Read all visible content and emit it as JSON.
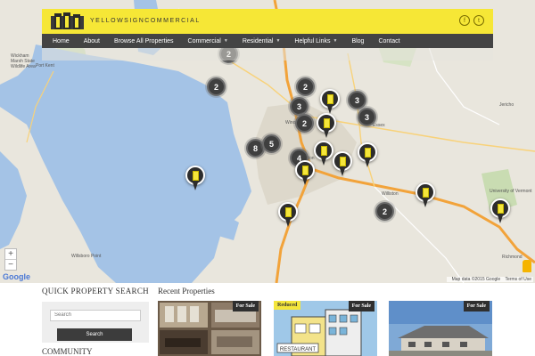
{
  "header": {
    "logo_text": "YELLOWSIGNCOMMERCIAL",
    "social": [
      "f",
      "t"
    ]
  },
  "nav": [
    {
      "label": "Home",
      "dropdown": false
    },
    {
      "label": "About",
      "dropdown": false
    },
    {
      "label": "Browse All Properties",
      "dropdown": false
    },
    {
      "label": "Commercial",
      "dropdown": true
    },
    {
      "label": "Residential",
      "dropdown": true
    },
    {
      "label": "Helpful Links",
      "dropdown": true
    },
    {
      "label": "Blog",
      "dropdown": false
    },
    {
      "label": "Contact",
      "dropdown": false
    }
  ],
  "map": {
    "place_labels": [
      "Wickham Marsh State Wildlife Area",
      "Port Kent",
      "Willsboro Point",
      "Jericho",
      "Williston",
      "Richmond",
      "University of Vermont",
      "Essex",
      "Winooski",
      "Burlington"
    ],
    "clusters": [
      {
        "count": "2"
      },
      {
        "count": "2"
      },
      {
        "count": "2"
      },
      {
        "count": "3"
      },
      {
        "count": "3"
      },
      {
        "count": "3"
      },
      {
        "count": "2"
      },
      {
        "count": "8"
      },
      {
        "count": "5"
      },
      {
        "count": "4"
      },
      {
        "count": "2"
      }
    ],
    "pin_count": 10,
    "zoom_in": "+",
    "zoom_out": "−",
    "google_label": "Google",
    "attribution": "Map data ©2015 Google",
    "terms": "Terms of Use"
  },
  "sidebar": {
    "title": "QUICK PROPERTY SEARCH",
    "search_placeholder": "Search",
    "search_button": "Search",
    "community_title": "COMMUNITY"
  },
  "recent": {
    "title": "Recent Properties",
    "cards": [
      {
        "badge": "For Sale",
        "reduced": ""
      },
      {
        "badge": "For Sale",
        "reduced": "Reduced"
      },
      {
        "badge": "For Sale",
        "reduced": ""
      }
    ]
  },
  "colors": {
    "brand_yellow": "#f6e736",
    "nav_bg": "#444444",
    "water": "#a4c3e6",
    "highway": "#f2a33a"
  }
}
